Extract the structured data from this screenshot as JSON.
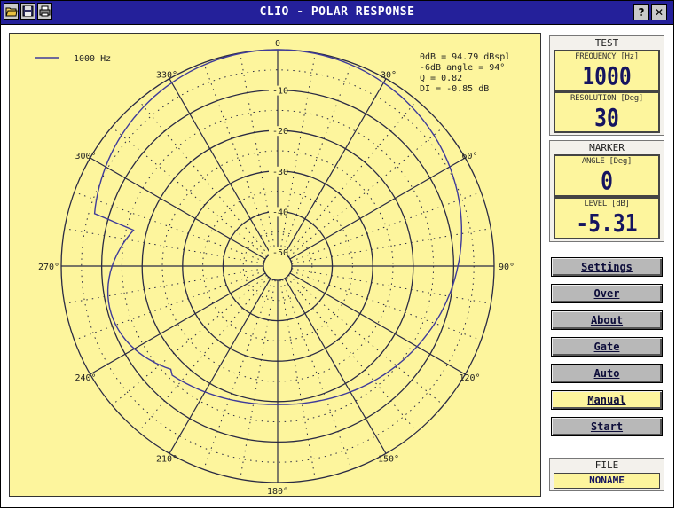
{
  "window": {
    "title": "CLIO - POLAR RESPONSE",
    "icons": [
      "open-folder-icon",
      "save-disk-icon",
      "print-icon"
    ],
    "help_label": "?",
    "close_label": "✕"
  },
  "plot": {
    "legend_label": "1000 Hz",
    "info_lines": [
      "0dB = 94.79 dBspl",
      "-6dB angle = 94°",
      "Q = 0.82",
      "DI = -0.85 dB"
    ],
    "angle_labels": [
      {
        "angle": 0,
        "text": "0"
      },
      {
        "angle": 30,
        "text": "30°"
      },
      {
        "angle": 60,
        "text": "60°"
      },
      {
        "angle": 90,
        "text": "90°"
      },
      {
        "angle": 120,
        "text": "120°"
      },
      {
        "angle": 150,
        "text": "150°"
      },
      {
        "angle": 180,
        "text": "180°"
      },
      {
        "angle": 210,
        "text": "210°"
      },
      {
        "angle": 240,
        "text": "240°"
      },
      {
        "angle": 270,
        "text": "270°"
      },
      {
        "angle": 300,
        "text": "300°"
      },
      {
        "angle": 330,
        "text": "330°"
      }
    ],
    "ring_labels": [
      "-10",
      "-20",
      "-30",
      "-40",
      "-50"
    ]
  },
  "chart_data": {
    "type": "polar",
    "series": [
      {
        "name": "1000 Hz",
        "color": "#3f3b9a"
      }
    ],
    "radial_range_db": [
      -50,
      0
    ],
    "angle_step_deg": 30,
    "grid": true,
    "legend": "top-left"
  },
  "test_panel": {
    "title": "TEST",
    "frequency_label": "FREQUENCY [Hz]",
    "frequency_value": "1000",
    "resolution_label": "RESOLUTION [Deg]",
    "resolution_value": "30"
  },
  "marker_panel": {
    "title": "MARKER",
    "angle_label": "ANGLE [Deg]",
    "angle_value": "0",
    "level_label": "LEVEL [dB]",
    "level_value": "-5.31"
  },
  "buttons": {
    "settings": "Settings",
    "over": "Over",
    "about": "About",
    "gate": "Gate",
    "auto": "Auto",
    "manual": "Manual",
    "start": "Start"
  },
  "file_panel": {
    "title": "FILE",
    "filename": "NONAME"
  },
  "colors": {
    "titlebar": "#24209a",
    "plot_background": "#fdf59d",
    "grid": "#2a2a44",
    "curve": "#3f3b9a",
    "lcd_digits": "#151460"
  }
}
